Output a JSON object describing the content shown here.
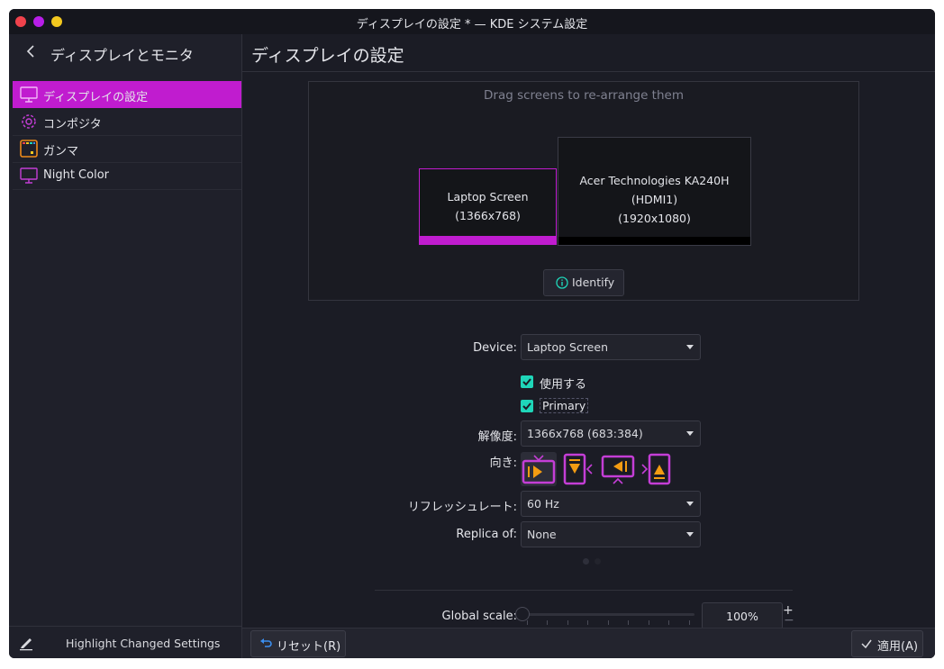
{
  "window": {
    "title": "ディスプレイの設定 * — KDE システム設定",
    "controls": [
      "close",
      "minimize",
      "maximize"
    ],
    "colors": {
      "close": "#f0424c",
      "minimize": "#b81ee8",
      "maximize": "#f3c81f"
    }
  },
  "sidebar": {
    "title": "ディスプレイとモニタ",
    "items": [
      {
        "label": "ディスプレイの設定",
        "icon": "display-icon",
        "active": true
      },
      {
        "label": "コンポジタ",
        "icon": "gear-icon",
        "active": false
      },
      {
        "label": "ガンマ",
        "icon": "gamma-icon",
        "active": false
      },
      {
        "label": "Night Color",
        "icon": "night-color-icon",
        "active": false
      }
    ],
    "footer_label": "Highlight Changed Settings"
  },
  "main": {
    "title": "ディスプレイの設定",
    "arrange_hint": "Drag screens to re-arrange them",
    "screens": [
      {
        "name": "Laptop Screen",
        "resolution": "(1366x768)",
        "selected": true
      },
      {
        "name": "Acer Technologies KA240H (HDMI1)",
        "resolution": "(1920x1080)",
        "selected": false
      }
    ],
    "identify_label": "Identify",
    "form": {
      "device_label": "Device:",
      "device_value": "Laptop Screen",
      "enabled_label": "使用する",
      "enabled_checked": true,
      "primary_label": "Primary",
      "primary_checked": true,
      "resolution_label": "解像度:",
      "resolution_value": "1366x768 (683:384)",
      "orientation_label": "向き:",
      "orientations": [
        "landscape-icon",
        "portrait-right-icon",
        "landscape-flipped-icon",
        "portrait-left-icon"
      ],
      "orientation_selected": 0,
      "refresh_label": "リフレッシュレート:",
      "refresh_value": "60 Hz",
      "replica_label": "Replica of:",
      "replica_value": "None",
      "scale_label": "Global scale:",
      "scale_value": "100%",
      "scale_fraction": 0.0,
      "scale_plus": "+",
      "scale_minus": "−"
    },
    "pages": {
      "count": 2,
      "current": 0
    }
  },
  "buttons": {
    "reset_label": "リセット(R)",
    "apply_label": "適用(A)"
  },
  "accent": "#c01ccf",
  "check_color": "#1fd6b9"
}
